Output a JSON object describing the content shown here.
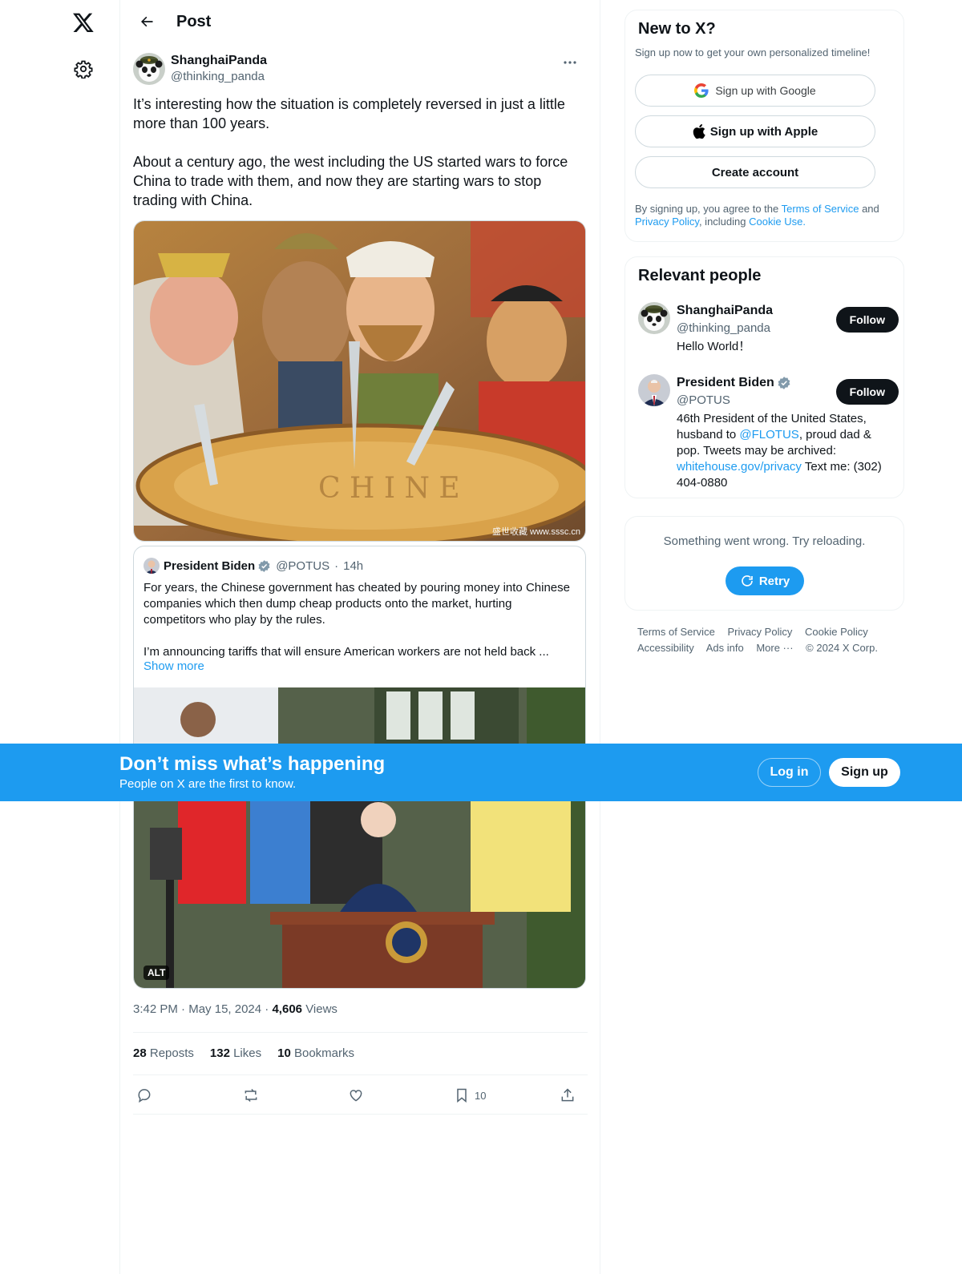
{
  "header": {
    "title": "Post"
  },
  "tweet": {
    "author_name": "ShanghaiPanda",
    "author_handle": "@thinking_panda",
    "text_p1": "It’s interesting how the situation is completely reversed in just a little more than 100 years.",
    "text_p2": "About a century ago, the west including the US started wars to force China to trade with them, and now they are starting wars to stop trading with China.",
    "image_watermark": "盛世收藏 www.sssc.cn",
    "quote": {
      "author_name": "President Biden",
      "author_handle": "@POTUS",
      "time": "14h",
      "text_p1": "For years, the Chinese government has cheated by pouring money into Chinese companies which then dump cheap products onto the market, hurting competitors who play by the rules.",
      "text_p2": "I’m announcing tariffs that will ensure American workers are not held back ...",
      "show_more": "Show more",
      "alt_badge": "ALT"
    },
    "time": "3:42 PM",
    "date": "May 15, 2024",
    "views_count": "4,606",
    "views_label": "Views",
    "reposts_count": "28",
    "reposts_label": "Reposts",
    "likes_count": "132",
    "likes_label": "Likes",
    "bookmarks_count": "10",
    "bookmarks_label": "Bookmarks",
    "bookmark_action_count": "10"
  },
  "signup_card": {
    "title": "New to X?",
    "subtitle": "Sign up now to get your own personalized timeline!",
    "google_label": "Sign up with Google",
    "apple_label": "Sign up with Apple",
    "create_label": "Create account",
    "legal_prefix": "By signing up, you agree to the",
    "terms": "Terms of Service",
    "and": "and",
    "privacy": "Privacy Policy",
    "including": ", including",
    "cookie": "Cookie Use."
  },
  "people_card": {
    "title": "Relevant people",
    "people": [
      {
        "name": "ShanghaiPanda",
        "handle": "@thinking_panda",
        "bio": "Hello World！",
        "follow": "Follow"
      },
      {
        "name": "President Biden",
        "handle": "@POTUS",
        "bio_1": "46th President of the United States, husband to",
        "bio_link_1": "@FLOTUS",
        "bio_2": ", proud dad & pop. Tweets may be archived:",
        "bio_link_2": "whitehouse.gov/privacy",
        "bio_3": "Text me: (302) 404-0880",
        "follow": "Follow"
      }
    ]
  },
  "error_card": {
    "message": "Something went wrong. Try reloading.",
    "retry": "Retry"
  },
  "footer": {
    "terms": "Terms of Service",
    "privacy": "Privacy Policy",
    "cookie": "Cookie Policy",
    "accessibility": "Accessibility",
    "ads": "Ads info",
    "more": "More ···",
    "copyright": "© 2024 X Corp."
  },
  "banner": {
    "title": "Don’t miss what’s happening",
    "subtitle": "People on X are the first to know.",
    "login": "Log in",
    "signup": "Sign up"
  },
  "colors": {
    "accent": "#1d9bf0",
    "text": "#0f1419",
    "muted": "#536471",
    "border": "#eff3f4"
  },
  "icons": [
    "x-logo-icon",
    "gear-icon",
    "back-arrow-icon",
    "more-icon",
    "verified-icon",
    "reply-icon",
    "repost-icon",
    "like-icon",
    "bookmark-icon",
    "share-icon",
    "google-icon",
    "apple-icon",
    "refresh-icon"
  ]
}
